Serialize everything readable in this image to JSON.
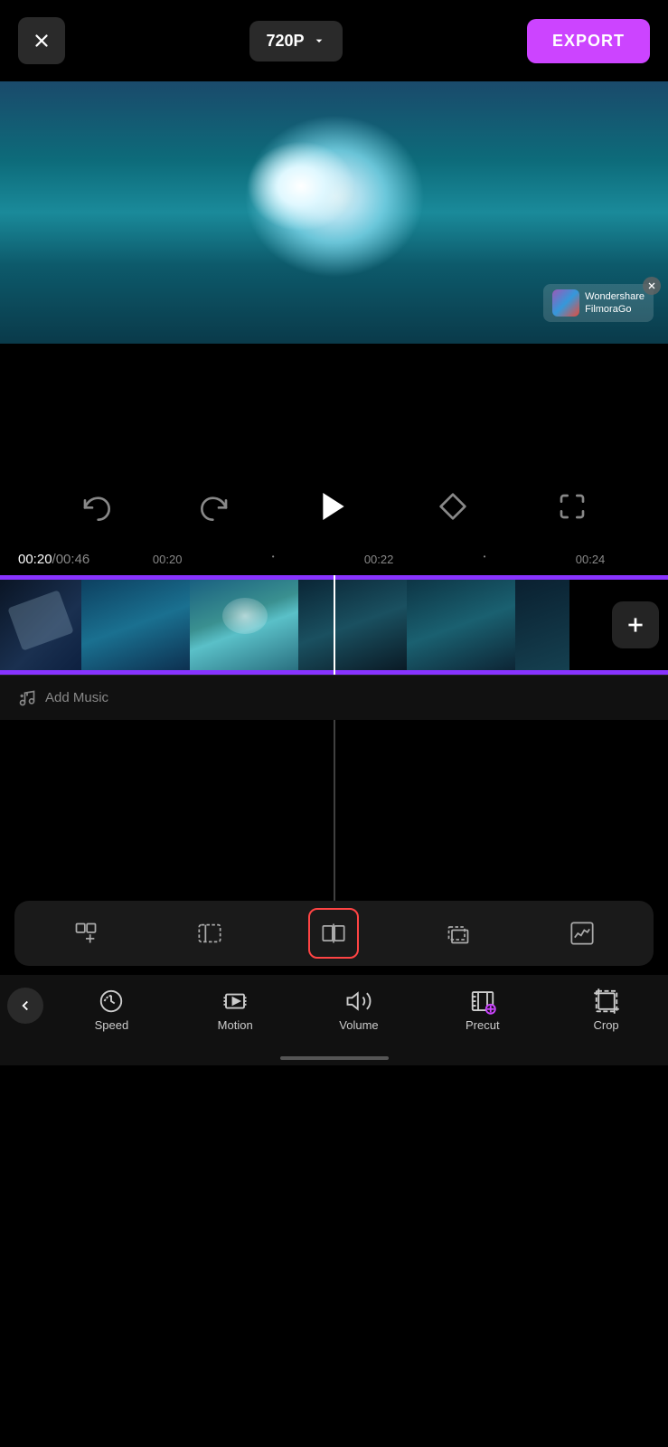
{
  "header": {
    "quality_label": "720P",
    "export_label": "EXPORT"
  },
  "watermark": {
    "brand_name": "Wondershare\nFilmoraGo"
  },
  "playback": {
    "current_time": "00:20",
    "total_time": "00:46",
    "marker1": "00:20",
    "marker2": "00:22",
    "marker3": "00:24"
  },
  "timeline": {
    "add_music_label": "Add Music"
  },
  "edit_toolbar": {
    "tools": [
      {
        "id": "add-clip",
        "label": "Add Clip"
      },
      {
        "id": "trim",
        "label": "Trim"
      },
      {
        "id": "split",
        "label": "Split"
      },
      {
        "id": "crop-tool",
        "label": "Crop"
      },
      {
        "id": "adjust",
        "label": "Adjust"
      }
    ]
  },
  "bottom_nav": {
    "back_label": "<",
    "items": [
      {
        "id": "speed",
        "label": "Speed"
      },
      {
        "id": "motion",
        "label": "Motion"
      },
      {
        "id": "volume",
        "label": "Volume"
      },
      {
        "id": "precut",
        "label": "Precut"
      },
      {
        "id": "crop",
        "label": "Crop"
      }
    ]
  }
}
